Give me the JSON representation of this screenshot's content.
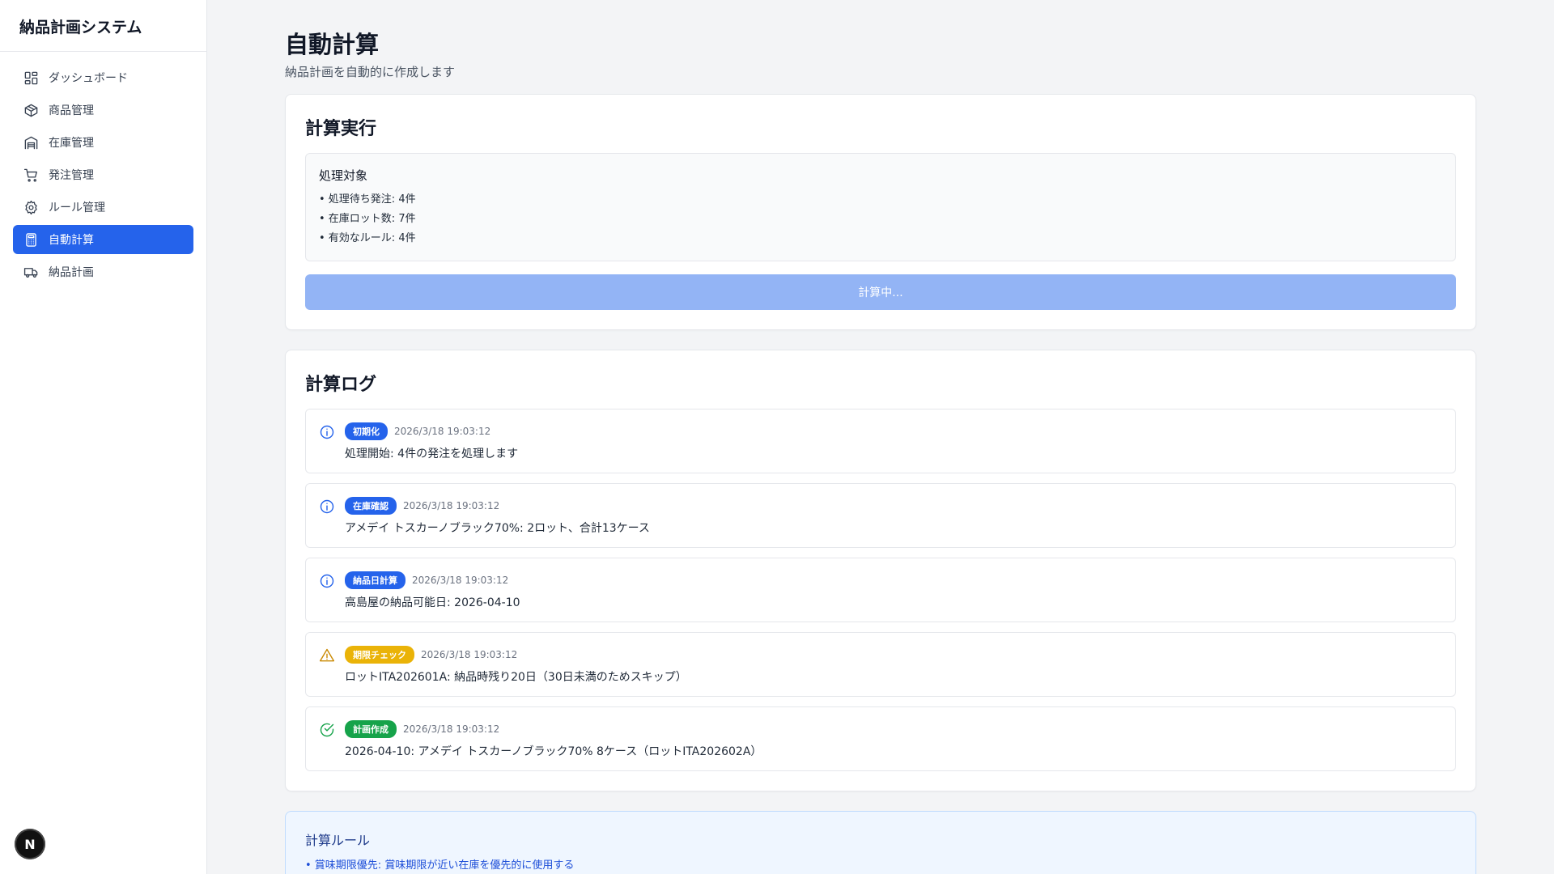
{
  "app": {
    "title": "納品計画システム"
  },
  "sidebar": {
    "items": [
      {
        "label": "ダッシュボード"
      },
      {
        "label": "商品管理"
      },
      {
        "label": "在庫管理"
      },
      {
        "label": "発注管理"
      },
      {
        "label": "ルール管理"
      },
      {
        "label": "自動計算"
      },
      {
        "label": "納品計画"
      }
    ],
    "active_index": 5,
    "active_color": "#2563eb"
  },
  "badge": {
    "letter": "N"
  },
  "page": {
    "title": "自動計算",
    "subtitle": "納品計画を自動的に作成します"
  },
  "exec": {
    "title": "計算実行",
    "target_title": "処理対象",
    "lines": [
      "• 処理待ち発注: 4件",
      "• 在庫ロット数: 7件",
      "• 有効なルール: 4件"
    ],
    "button_label": "計算中..."
  },
  "log": {
    "title": "計算ログ",
    "entries": [
      {
        "type": "info",
        "icon": "info-icon",
        "tag": "初期化",
        "time": "2026/3/18 19:03:12",
        "message": "処理開始: 4件の発注を処理します"
      },
      {
        "type": "info",
        "icon": "info-icon",
        "tag": "在庫確認",
        "time": "2026/3/18 19:03:12",
        "message": "アメデイ トスカーノブラック70%: 2ロット、合計13ケース"
      },
      {
        "type": "info",
        "icon": "info-icon",
        "tag": "納品日計算",
        "time": "2026/3/18 19:03:12",
        "message": "高島屋の納品可能日: 2026-04-10"
      },
      {
        "type": "warn",
        "icon": "warning-icon",
        "tag": "期限チェック",
        "time": "2026/3/18 19:03:12",
        "message": "ロットITA202601A: 納品時残り20日（30日未満のためスキップ）"
      },
      {
        "type": "ok",
        "icon": "check-circle-icon",
        "tag": "計画作成",
        "time": "2026/3/18 19:03:12",
        "message": "2026-04-10: アメデイ トスカーノブラック70% 8ケース（ロットITA202602A）"
      }
    ],
    "colors": {
      "info": "#2563eb",
      "warn": "#eab308",
      "ok": "#16a34a"
    }
  },
  "rules": {
    "title": "計算ルール",
    "lines": [
      "• 賞味期限優先: 賞味期限が近い在庫を優先的に使用する"
    ]
  }
}
